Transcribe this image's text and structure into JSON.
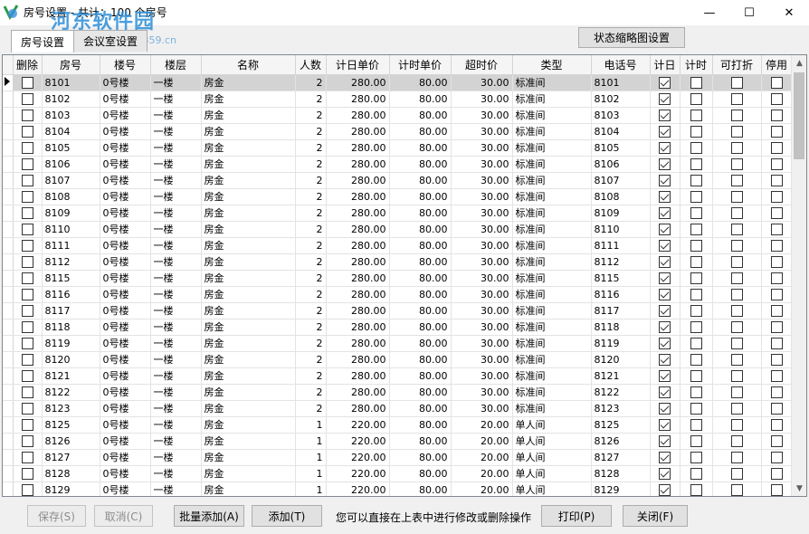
{
  "window": {
    "title": "房号设置 - 共计：100 个房号",
    "watermark": "河东软件园",
    "watermark_url": "www.pc0359.cn",
    "minimize_label": "—",
    "maximize_label": "☐",
    "close_label": "✕"
  },
  "tabs": [
    {
      "label": "房号设置",
      "active": true
    },
    {
      "label": "会议室设置",
      "active": false
    }
  ],
  "status_button": "状态缩略图设置",
  "table": {
    "headers": [
      "删除",
      "房号",
      "楼号",
      "楼层",
      "名称",
      "人数",
      "计日单价",
      "计时单价",
      "超时价",
      "类型",
      "电话号",
      "计日",
      "计时",
      "可打折",
      "停用"
    ],
    "rows": [
      {
        "room": "8101",
        "building": "0号楼",
        "floor": "一楼",
        "name": "房金",
        "people": "2",
        "day_price": "280.00",
        "hour_price": "80.00",
        "overtime": "30.00",
        "type": "标准间",
        "phone": "8101"
      },
      {
        "room": "8102",
        "building": "0号楼",
        "floor": "一楼",
        "name": "房金",
        "people": "2",
        "day_price": "280.00",
        "hour_price": "80.00",
        "overtime": "30.00",
        "type": "标准间",
        "phone": "8102"
      },
      {
        "room": "8103",
        "building": "0号楼",
        "floor": "一楼",
        "name": "房金",
        "people": "2",
        "day_price": "280.00",
        "hour_price": "80.00",
        "overtime": "30.00",
        "type": "标准间",
        "phone": "8103"
      },
      {
        "room": "8104",
        "building": "0号楼",
        "floor": "一楼",
        "name": "房金",
        "people": "2",
        "day_price": "280.00",
        "hour_price": "80.00",
        "overtime": "30.00",
        "type": "标准间",
        "phone": "8104"
      },
      {
        "room": "8105",
        "building": "0号楼",
        "floor": "一楼",
        "name": "房金",
        "people": "2",
        "day_price": "280.00",
        "hour_price": "80.00",
        "overtime": "30.00",
        "type": "标准间",
        "phone": "8105"
      },
      {
        "room": "8106",
        "building": "0号楼",
        "floor": "一楼",
        "name": "房金",
        "people": "2",
        "day_price": "280.00",
        "hour_price": "80.00",
        "overtime": "30.00",
        "type": "标准间",
        "phone": "8106"
      },
      {
        "room": "8107",
        "building": "0号楼",
        "floor": "一楼",
        "name": "房金",
        "people": "2",
        "day_price": "280.00",
        "hour_price": "80.00",
        "overtime": "30.00",
        "type": "标准间",
        "phone": "8107"
      },
      {
        "room": "8108",
        "building": "0号楼",
        "floor": "一楼",
        "name": "房金",
        "people": "2",
        "day_price": "280.00",
        "hour_price": "80.00",
        "overtime": "30.00",
        "type": "标准间",
        "phone": "8108"
      },
      {
        "room": "8109",
        "building": "0号楼",
        "floor": "一楼",
        "name": "房金",
        "people": "2",
        "day_price": "280.00",
        "hour_price": "80.00",
        "overtime": "30.00",
        "type": "标准间",
        "phone": "8109"
      },
      {
        "room": "8110",
        "building": "0号楼",
        "floor": "一楼",
        "name": "房金",
        "people": "2",
        "day_price": "280.00",
        "hour_price": "80.00",
        "overtime": "30.00",
        "type": "标准间",
        "phone": "8110"
      },
      {
        "room": "8111",
        "building": "0号楼",
        "floor": "一楼",
        "name": "房金",
        "people": "2",
        "day_price": "280.00",
        "hour_price": "80.00",
        "overtime": "30.00",
        "type": "标准间",
        "phone": "8111"
      },
      {
        "room": "8112",
        "building": "0号楼",
        "floor": "一楼",
        "name": "房金",
        "people": "2",
        "day_price": "280.00",
        "hour_price": "80.00",
        "overtime": "30.00",
        "type": "标准间",
        "phone": "8112"
      },
      {
        "room": "8115",
        "building": "0号楼",
        "floor": "一楼",
        "name": "房金",
        "people": "2",
        "day_price": "280.00",
        "hour_price": "80.00",
        "overtime": "30.00",
        "type": "标准间",
        "phone": "8115"
      },
      {
        "room": "8116",
        "building": "0号楼",
        "floor": "一楼",
        "name": "房金",
        "people": "2",
        "day_price": "280.00",
        "hour_price": "80.00",
        "overtime": "30.00",
        "type": "标准间",
        "phone": "8116"
      },
      {
        "room": "8117",
        "building": "0号楼",
        "floor": "一楼",
        "name": "房金",
        "people": "2",
        "day_price": "280.00",
        "hour_price": "80.00",
        "overtime": "30.00",
        "type": "标准间",
        "phone": "8117"
      },
      {
        "room": "8118",
        "building": "0号楼",
        "floor": "一楼",
        "name": "房金",
        "people": "2",
        "day_price": "280.00",
        "hour_price": "80.00",
        "overtime": "30.00",
        "type": "标准间",
        "phone": "8118"
      },
      {
        "room": "8119",
        "building": "0号楼",
        "floor": "一楼",
        "name": "房金",
        "people": "2",
        "day_price": "280.00",
        "hour_price": "80.00",
        "overtime": "30.00",
        "type": "标准间",
        "phone": "8119"
      },
      {
        "room": "8120",
        "building": "0号楼",
        "floor": "一楼",
        "name": "房金",
        "people": "2",
        "day_price": "280.00",
        "hour_price": "80.00",
        "overtime": "30.00",
        "type": "标准间",
        "phone": "8120"
      },
      {
        "room": "8121",
        "building": "0号楼",
        "floor": "一楼",
        "name": "房金",
        "people": "2",
        "day_price": "280.00",
        "hour_price": "80.00",
        "overtime": "30.00",
        "type": "标准间",
        "phone": "8121"
      },
      {
        "room": "8122",
        "building": "0号楼",
        "floor": "一楼",
        "name": "房金",
        "people": "2",
        "day_price": "280.00",
        "hour_price": "80.00",
        "overtime": "30.00",
        "type": "标准间",
        "phone": "8122"
      },
      {
        "room": "8123",
        "building": "0号楼",
        "floor": "一楼",
        "name": "房金",
        "people": "2",
        "day_price": "280.00",
        "hour_price": "80.00",
        "overtime": "30.00",
        "type": "标准间",
        "phone": "8123"
      },
      {
        "room": "8125",
        "building": "0号楼",
        "floor": "一楼",
        "name": "房金",
        "people": "1",
        "day_price": "220.00",
        "hour_price": "80.00",
        "overtime": "20.00",
        "type": "单人间",
        "phone": "8125"
      },
      {
        "room": "8126",
        "building": "0号楼",
        "floor": "一楼",
        "name": "房金",
        "people": "1",
        "day_price": "220.00",
        "hour_price": "80.00",
        "overtime": "20.00",
        "type": "单人间",
        "phone": "8126"
      },
      {
        "room": "8127",
        "building": "0号楼",
        "floor": "一楼",
        "name": "房金",
        "people": "1",
        "day_price": "220.00",
        "hour_price": "80.00",
        "overtime": "20.00",
        "type": "单人间",
        "phone": "8127"
      },
      {
        "room": "8128",
        "building": "0号楼",
        "floor": "一楼",
        "name": "房金",
        "people": "1",
        "day_price": "220.00",
        "hour_price": "80.00",
        "overtime": "20.00",
        "type": "单人间",
        "phone": "8128"
      },
      {
        "room": "8129",
        "building": "0号楼",
        "floor": "一楼",
        "name": "房金",
        "people": "1",
        "day_price": "220.00",
        "hour_price": "80.00",
        "overtime": "20.00",
        "type": "单人间",
        "phone": "8129"
      }
    ],
    "selected_row": 0
  },
  "buttons": {
    "save": "保存(S)",
    "cancel": "取消(C)",
    "batch_add": "批量添加(A)",
    "add": "添加(T)",
    "print": "打印(P)",
    "close": "关闭(F)"
  },
  "hint": "您可以直接在上表中进行修改或删除操作",
  "colors": {
    "selected_row": "#d3d3d3",
    "watermark": "#2f8fd8"
  }
}
